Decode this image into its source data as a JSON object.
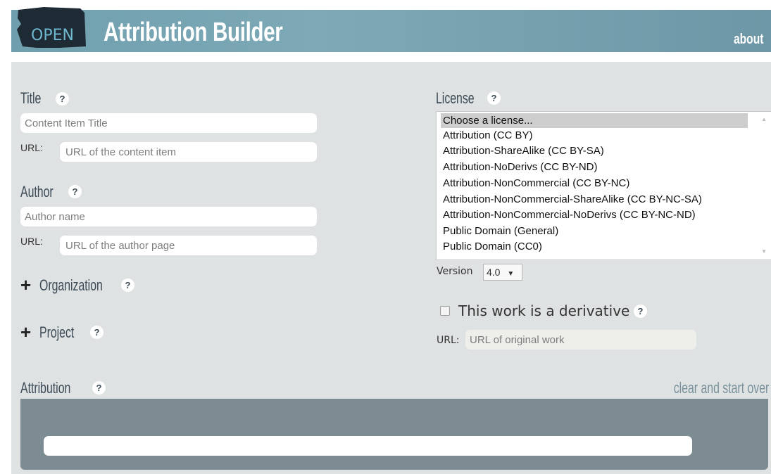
{
  "header": {
    "logo_text": "OPEN",
    "title": "Attribution Builder",
    "about_label": "about"
  },
  "title_section": {
    "label": "Title",
    "help": "?",
    "placeholder": "Content Item Title",
    "url_label": "URL:",
    "url_placeholder": "URL of the content item"
  },
  "author_section": {
    "label": "Author",
    "help": "?",
    "placeholder": "Author name",
    "url_label": "URL:",
    "url_placeholder": "URL of the author page"
  },
  "organization": {
    "plus": "+",
    "label": "Organization",
    "help": "?"
  },
  "project": {
    "plus": "+",
    "label": "Project",
    "help": "?"
  },
  "license": {
    "label": "License",
    "help": "?",
    "options": [
      "Choose a license...",
      "Attribution (CC BY)",
      "Attribution-ShareAlike (CC BY-SA)",
      "Attribution-NoDerivs (CC BY-ND)",
      "Attribution-NonCommercial (CC BY-NC)",
      "Attribution-NonCommercial-ShareAlike (CC BY-NC-SA)",
      "Attribution-NonCommercial-NoDerivs (CC BY-NC-ND)",
      "Public Domain (General)",
      "Public Domain (CC0)"
    ],
    "selected_index": 0,
    "version_label": "Version",
    "version_value": "4.0",
    "version_arrow": "▼"
  },
  "derivative": {
    "label": "This work is a derivative",
    "help": "?",
    "checked": false,
    "url_label": "URL:",
    "url_placeholder": "URL of original work"
  },
  "attribution": {
    "label": "Attribution",
    "help": "?",
    "clear_label": "clear and start over",
    "output": ""
  },
  "colors": {
    "header_bg": "#7ea9b6",
    "panel_bg": "#dfe2e3",
    "attribution_box": "#7d8c93",
    "label_text": "#3b4a55",
    "clear_link": "#79909a"
  }
}
